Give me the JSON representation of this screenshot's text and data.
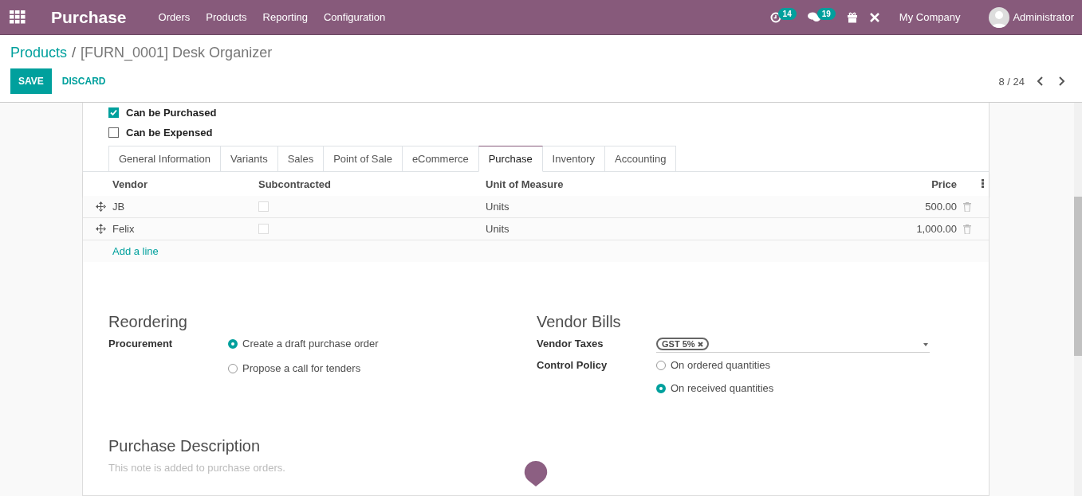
{
  "navbar": {
    "app_title": "Purchase",
    "menu": [
      "Orders",
      "Products",
      "Reporting",
      "Configuration"
    ],
    "activity_count": "14",
    "message_count": "19",
    "company": "My Company",
    "user": "Administrator"
  },
  "breadcrumb": {
    "parent": "Products",
    "separator": "/",
    "current": "[FURN_0001] Desk Organizer"
  },
  "buttons": {
    "save": "SAVE",
    "discard": "DISCARD"
  },
  "pager": "8 / 24",
  "checkboxes": [
    {
      "label": "Can be Purchased",
      "checked": true
    },
    {
      "label": "Can be Expensed",
      "checked": false
    }
  ],
  "tabs": [
    {
      "label": "General Information",
      "selected": false
    },
    {
      "label": "Variants",
      "selected": false
    },
    {
      "label": "Sales",
      "selected": false
    },
    {
      "label": "Point of Sale",
      "selected": false
    },
    {
      "label": "eCommerce",
      "selected": false
    },
    {
      "label": "Purchase",
      "selected": true
    },
    {
      "label": "Inventory",
      "selected": false
    },
    {
      "label": "Accounting",
      "selected": false
    }
  ],
  "vendor_table": {
    "columns": [
      "Vendor",
      "Subcontracted",
      "Unit of Measure",
      "Price"
    ],
    "rows": [
      {
        "vendor": "JB",
        "subcontracted": false,
        "uom": "Units",
        "price": "500.00"
      },
      {
        "vendor": "Felix",
        "subcontracted": false,
        "uom": "Units",
        "price": "1,000.00"
      }
    ],
    "add_line": "Add a line"
  },
  "reordering": {
    "title": "Reordering",
    "label": "Procurement",
    "options": [
      {
        "label": "Create a draft purchase order",
        "selected": true
      },
      {
        "label": "Propose a call for tenders",
        "selected": false
      }
    ]
  },
  "vendor_bills": {
    "title": "Vendor Bills",
    "taxes_label": "Vendor Taxes",
    "taxes": [
      "GST 5%"
    ],
    "policy_label": "Control Policy",
    "options": [
      {
        "label": "On ordered quantities",
        "selected": false
      },
      {
        "label": "On received quantities",
        "selected": true
      }
    ]
  },
  "purchase_description": {
    "title": "Purchase Description",
    "placeholder": "This note is added to purchase orders."
  }
}
